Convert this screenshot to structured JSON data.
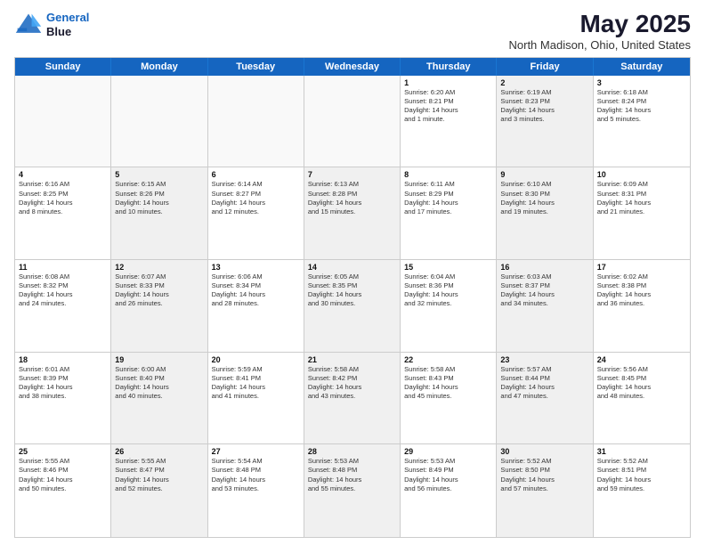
{
  "logo": {
    "line1": "General",
    "line2": "Blue"
  },
  "title": "May 2025",
  "subtitle": "North Madison, Ohio, United States",
  "header_days": [
    "Sunday",
    "Monday",
    "Tuesday",
    "Wednesday",
    "Thursday",
    "Friday",
    "Saturday"
  ],
  "weeks": [
    [
      {
        "day": "",
        "info": "",
        "empty": true
      },
      {
        "day": "",
        "info": "",
        "empty": true
      },
      {
        "day": "",
        "info": "",
        "empty": true
      },
      {
        "day": "",
        "info": "",
        "empty": true
      },
      {
        "day": "1",
        "info": "Sunrise: 6:20 AM\nSunset: 8:21 PM\nDaylight: 14 hours\nand 1 minute.",
        "empty": false
      },
      {
        "day": "2",
        "info": "Sunrise: 6:19 AM\nSunset: 8:23 PM\nDaylight: 14 hours\nand 3 minutes.",
        "empty": false,
        "shaded": true
      },
      {
        "day": "3",
        "info": "Sunrise: 6:18 AM\nSunset: 8:24 PM\nDaylight: 14 hours\nand 5 minutes.",
        "empty": false
      }
    ],
    [
      {
        "day": "4",
        "info": "Sunrise: 6:16 AM\nSunset: 8:25 PM\nDaylight: 14 hours\nand 8 minutes.",
        "empty": false
      },
      {
        "day": "5",
        "info": "Sunrise: 6:15 AM\nSunset: 8:26 PM\nDaylight: 14 hours\nand 10 minutes.",
        "empty": false,
        "shaded": true
      },
      {
        "day": "6",
        "info": "Sunrise: 6:14 AM\nSunset: 8:27 PM\nDaylight: 14 hours\nand 12 minutes.",
        "empty": false
      },
      {
        "day": "7",
        "info": "Sunrise: 6:13 AM\nSunset: 8:28 PM\nDaylight: 14 hours\nand 15 minutes.",
        "empty": false,
        "shaded": true
      },
      {
        "day": "8",
        "info": "Sunrise: 6:11 AM\nSunset: 8:29 PM\nDaylight: 14 hours\nand 17 minutes.",
        "empty": false
      },
      {
        "day": "9",
        "info": "Sunrise: 6:10 AM\nSunset: 8:30 PM\nDaylight: 14 hours\nand 19 minutes.",
        "empty": false,
        "shaded": true
      },
      {
        "day": "10",
        "info": "Sunrise: 6:09 AM\nSunset: 8:31 PM\nDaylight: 14 hours\nand 21 minutes.",
        "empty": false
      }
    ],
    [
      {
        "day": "11",
        "info": "Sunrise: 6:08 AM\nSunset: 8:32 PM\nDaylight: 14 hours\nand 24 minutes.",
        "empty": false
      },
      {
        "day": "12",
        "info": "Sunrise: 6:07 AM\nSunset: 8:33 PM\nDaylight: 14 hours\nand 26 minutes.",
        "empty": false,
        "shaded": true
      },
      {
        "day": "13",
        "info": "Sunrise: 6:06 AM\nSunset: 8:34 PM\nDaylight: 14 hours\nand 28 minutes.",
        "empty": false
      },
      {
        "day": "14",
        "info": "Sunrise: 6:05 AM\nSunset: 8:35 PM\nDaylight: 14 hours\nand 30 minutes.",
        "empty": false,
        "shaded": true
      },
      {
        "day": "15",
        "info": "Sunrise: 6:04 AM\nSunset: 8:36 PM\nDaylight: 14 hours\nand 32 minutes.",
        "empty": false
      },
      {
        "day": "16",
        "info": "Sunrise: 6:03 AM\nSunset: 8:37 PM\nDaylight: 14 hours\nand 34 minutes.",
        "empty": false,
        "shaded": true
      },
      {
        "day": "17",
        "info": "Sunrise: 6:02 AM\nSunset: 8:38 PM\nDaylight: 14 hours\nand 36 minutes.",
        "empty": false
      }
    ],
    [
      {
        "day": "18",
        "info": "Sunrise: 6:01 AM\nSunset: 8:39 PM\nDaylight: 14 hours\nand 38 minutes.",
        "empty": false
      },
      {
        "day": "19",
        "info": "Sunrise: 6:00 AM\nSunset: 8:40 PM\nDaylight: 14 hours\nand 40 minutes.",
        "empty": false,
        "shaded": true
      },
      {
        "day": "20",
        "info": "Sunrise: 5:59 AM\nSunset: 8:41 PM\nDaylight: 14 hours\nand 41 minutes.",
        "empty": false
      },
      {
        "day": "21",
        "info": "Sunrise: 5:58 AM\nSunset: 8:42 PM\nDaylight: 14 hours\nand 43 minutes.",
        "empty": false,
        "shaded": true
      },
      {
        "day": "22",
        "info": "Sunrise: 5:58 AM\nSunset: 8:43 PM\nDaylight: 14 hours\nand 45 minutes.",
        "empty": false
      },
      {
        "day": "23",
        "info": "Sunrise: 5:57 AM\nSunset: 8:44 PM\nDaylight: 14 hours\nand 47 minutes.",
        "empty": false,
        "shaded": true
      },
      {
        "day": "24",
        "info": "Sunrise: 5:56 AM\nSunset: 8:45 PM\nDaylight: 14 hours\nand 48 minutes.",
        "empty": false
      }
    ],
    [
      {
        "day": "25",
        "info": "Sunrise: 5:55 AM\nSunset: 8:46 PM\nDaylight: 14 hours\nand 50 minutes.",
        "empty": false
      },
      {
        "day": "26",
        "info": "Sunrise: 5:55 AM\nSunset: 8:47 PM\nDaylight: 14 hours\nand 52 minutes.",
        "empty": false,
        "shaded": true
      },
      {
        "day": "27",
        "info": "Sunrise: 5:54 AM\nSunset: 8:48 PM\nDaylight: 14 hours\nand 53 minutes.",
        "empty": false
      },
      {
        "day": "28",
        "info": "Sunrise: 5:53 AM\nSunset: 8:48 PM\nDaylight: 14 hours\nand 55 minutes.",
        "empty": false,
        "shaded": true
      },
      {
        "day": "29",
        "info": "Sunrise: 5:53 AM\nSunset: 8:49 PM\nDaylight: 14 hours\nand 56 minutes.",
        "empty": false
      },
      {
        "day": "30",
        "info": "Sunrise: 5:52 AM\nSunset: 8:50 PM\nDaylight: 14 hours\nand 57 minutes.",
        "empty": false,
        "shaded": true
      },
      {
        "day": "31",
        "info": "Sunrise: 5:52 AM\nSunset: 8:51 PM\nDaylight: 14 hours\nand 59 minutes.",
        "empty": false
      }
    ]
  ]
}
